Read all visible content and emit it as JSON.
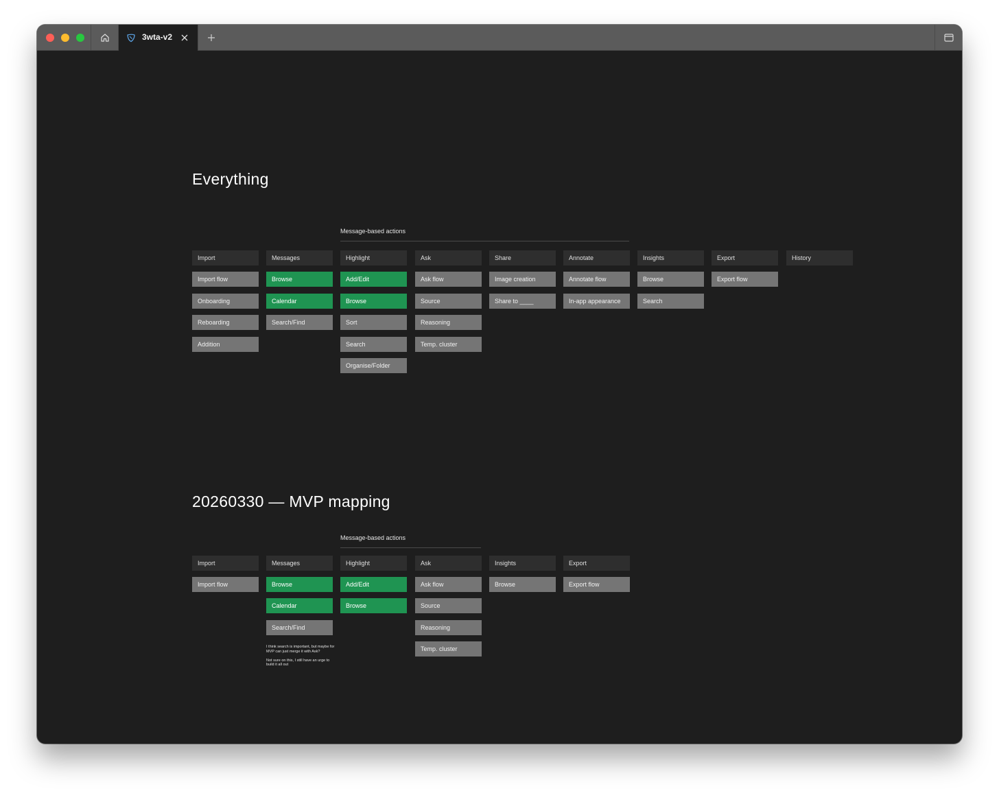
{
  "browser": {
    "tab_title": "3wta-v2"
  },
  "colors": {
    "green_card": "#1f9452",
    "gray_card": "#757575",
    "header_card": "#2e2e2e",
    "canvas": "#1e1e1e",
    "titlebar": "#5b5b5b"
  },
  "icons": {
    "home": "home-icon",
    "tab": "leaf-icon",
    "close": "close-icon",
    "new_tab": "plus-icon",
    "sidebar": "sidebar-toggle-icon"
  },
  "everything": {
    "title": "Everything",
    "group_label": "Message-based actions",
    "columns": [
      {
        "header": "Import",
        "items": [
          {
            "label": "Import flow",
            "style": "gray"
          },
          {
            "label": "Onboarding",
            "style": "gray"
          },
          {
            "label": "Reboarding",
            "style": "gray"
          },
          {
            "label": "Addition",
            "style": "gray"
          }
        ]
      },
      {
        "header": "Messages",
        "items": [
          {
            "label": "Browse",
            "style": "green"
          },
          {
            "label": "Calendar",
            "style": "green"
          },
          {
            "label": "Search/Find",
            "style": "gray"
          }
        ]
      },
      {
        "header": "Highlight",
        "items": [
          {
            "label": "Add/Edit",
            "style": "green"
          },
          {
            "label": "Browse",
            "style": "green"
          },
          {
            "label": "Sort",
            "style": "gray"
          },
          {
            "label": "Search",
            "style": "gray"
          },
          {
            "label": "Organise/Folder",
            "style": "gray"
          }
        ]
      },
      {
        "header": "Ask",
        "items": [
          {
            "label": "Ask flow",
            "style": "gray"
          },
          {
            "label": "Source",
            "style": "gray"
          },
          {
            "label": "Reasoning",
            "style": "gray"
          },
          {
            "label": "Temp. cluster",
            "style": "gray"
          }
        ]
      },
      {
        "header": "Share",
        "items": [
          {
            "label": "Image creation",
            "style": "gray"
          },
          {
            "label": "Share to ____",
            "style": "gray"
          }
        ]
      },
      {
        "header": "Annotate",
        "items": [
          {
            "label": "Annotate flow",
            "style": "gray"
          },
          {
            "label": "In-app appearance",
            "style": "gray"
          }
        ]
      },
      {
        "header": "Insights",
        "items": [
          {
            "label": "Browse",
            "style": "gray"
          },
          {
            "label": "Search",
            "style": "gray"
          }
        ]
      },
      {
        "header": "Export",
        "items": [
          {
            "label": "Export flow",
            "style": "gray"
          }
        ]
      },
      {
        "header": "History",
        "items": []
      }
    ]
  },
  "mvp": {
    "title": "20260330 — MVP mapping",
    "group_label": "Message-based actions",
    "note": "I think search is important, but maybe for MVP can just merge it with Ask?\n\nNot sure on this, I still have an urge to build it all out",
    "columns": [
      {
        "header": "Import",
        "items": [
          {
            "label": "Import flow",
            "style": "gray"
          }
        ]
      },
      {
        "header": "Messages",
        "items": [
          {
            "label": "Browse",
            "style": "green"
          },
          {
            "label": "Calendar",
            "style": "green"
          },
          {
            "label": "Search/Find",
            "style": "gray"
          }
        ]
      },
      {
        "header": "Highlight",
        "items": [
          {
            "label": "Add/Edit",
            "style": "green"
          },
          {
            "label": "Browse",
            "style": "green"
          }
        ]
      },
      {
        "header": "Ask",
        "items": [
          {
            "label": "Ask flow",
            "style": "gray"
          },
          {
            "label": "Source",
            "style": "gray"
          },
          {
            "label": "Reasoning",
            "style": "gray"
          },
          {
            "label": "Temp. cluster",
            "style": "gray"
          }
        ]
      },
      {
        "header": "Insights",
        "items": [
          {
            "label": "Browse",
            "style": "gray"
          }
        ]
      },
      {
        "header": "Export",
        "items": [
          {
            "label": "Export flow",
            "style": "gray"
          }
        ]
      }
    ]
  }
}
